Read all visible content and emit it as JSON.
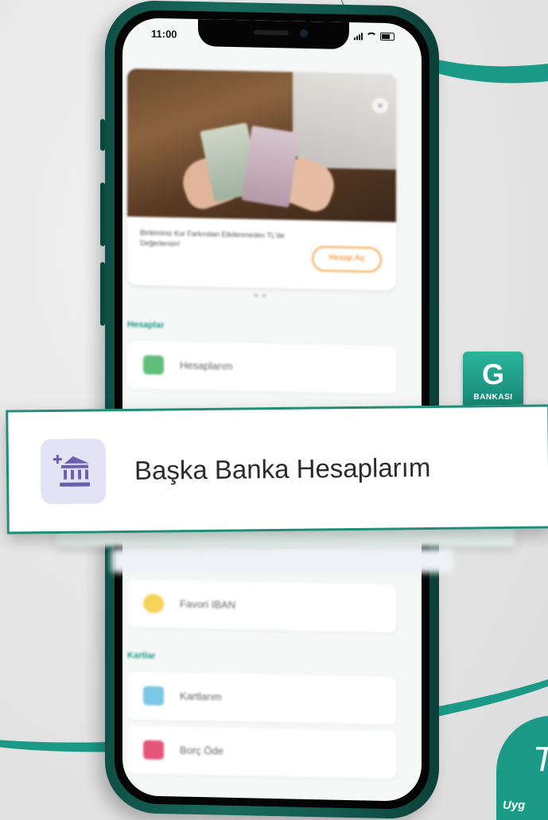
{
  "status_bar": {
    "time": "11:00"
  },
  "banner": {
    "text": "Birikiminiz Kur Farkından Etkilenmeden TL'de Değerlensin!",
    "button_label": "Hesap Aç",
    "close_glyph": "×"
  },
  "sections": {
    "accounts_title": "Hesaplar",
    "cards_title": "Kartlar"
  },
  "menu": {
    "my_accounts": "Hesaplarım",
    "favorite_iban": "Favori IBAN",
    "my_cards": "Kartlarım",
    "pay_debt": "Borç Öde"
  },
  "highlight": {
    "label": "Başka Banka Hesaplarım",
    "icon": "bank-add-icon"
  },
  "logo": {
    "letter": "G",
    "text": "BANKASI"
  },
  "corner_badge": {
    "big": "T",
    "small": "Uyg"
  },
  "colors": {
    "brand": "#1b9a87",
    "brand_dark": "#0f4f45",
    "accent_orange": "#f2a447",
    "icon_purple": "#6a5fb0",
    "icon_bg": "#e4e2f5"
  }
}
